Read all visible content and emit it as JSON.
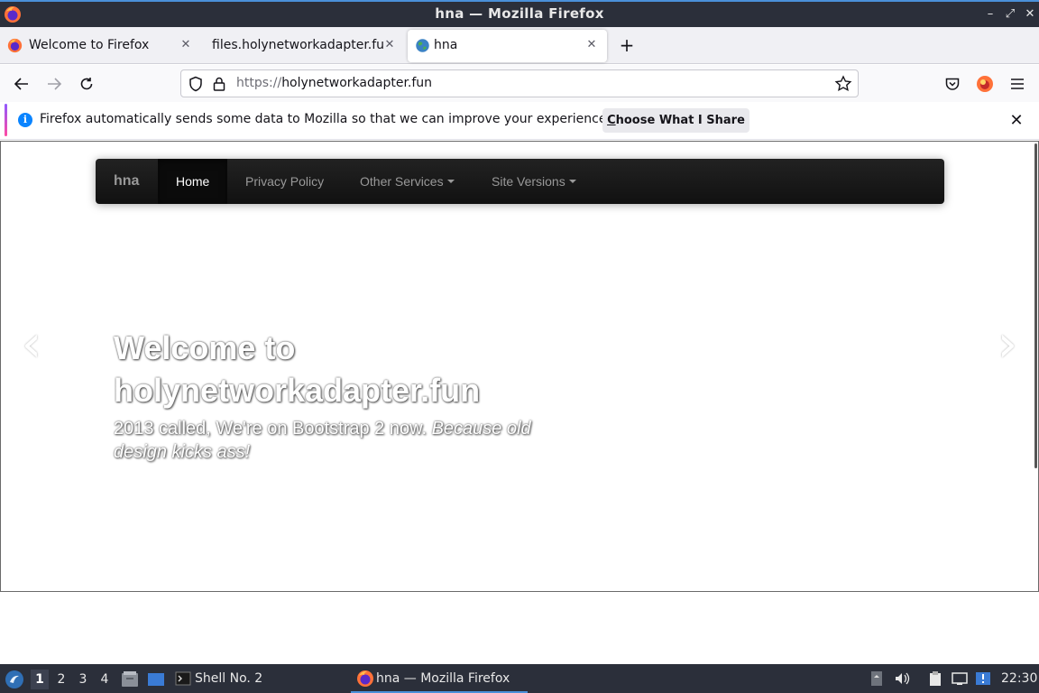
{
  "window": {
    "title": "hna — Mozilla Firefox"
  },
  "tabs": [
    {
      "label": "Welcome to Firefox",
      "icon": "firefox-icon"
    },
    {
      "label": "files.holynetworkadapter.fun",
      "icon": "none"
    },
    {
      "label": "hna",
      "icon": "globe-icon"
    }
  ],
  "new_tab": "+",
  "urlbar": {
    "scheme": "https://",
    "host": "holynetworkadapter.fun"
  },
  "notification": {
    "message": "Firefox automatically sends some data to Mozilla so that we can improve your experience.",
    "button_prefix": "C",
    "button_rest": "hoose What I Share"
  },
  "site": {
    "brand": "hna",
    "nav": [
      {
        "label": "Home",
        "active": true
      },
      {
        "label": "Privacy Policy",
        "active": false
      },
      {
        "label": "Other Services",
        "dropdown": true
      },
      {
        "label": "Site Versions",
        "dropdown": true
      }
    ],
    "hero": {
      "title_line1": "Welcome to",
      "title_line2": "holynetworkadapter.fun",
      "subtitle_plain": "2013 called, We're on Bootstrap 2 now. ",
      "subtitle_italic": "Because old design kicks ass!"
    },
    "carousel_prev": "‹",
    "carousel_next": "›"
  },
  "taskbar": {
    "workspaces": [
      "1",
      "2",
      "3",
      "4"
    ],
    "active_workspace": "1",
    "tasks": [
      {
        "label": "Shell No. 2",
        "icon": "terminal-icon"
      },
      {
        "label": "hna — Mozilla Firefox",
        "icon": "firefox-icon",
        "active": true
      }
    ],
    "clock": "22:30"
  },
  "colors": {
    "titlebar": "#2b2f3a",
    "accent": "#4a90d9",
    "site_nav": "#1b1b1b",
    "info_blue": "#0a84ff"
  }
}
